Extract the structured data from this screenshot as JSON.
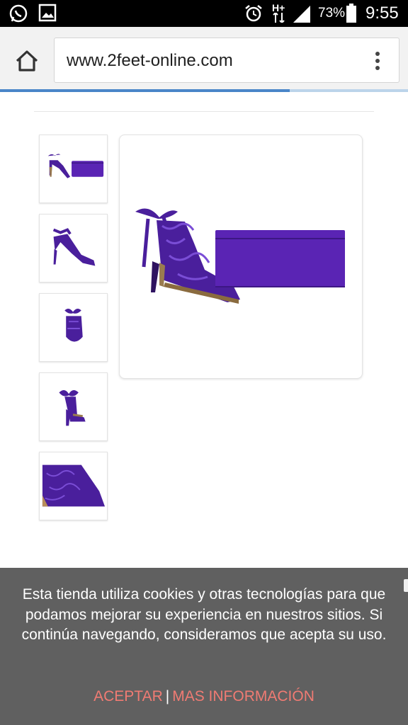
{
  "status_bar": {
    "battery_percent": "73%",
    "time": "9:55",
    "network_label": "H+",
    "icons": [
      "whatsapp-icon",
      "gallery-icon",
      "alarm-icon",
      "network-icon",
      "signal-icon",
      "battery-icon"
    ]
  },
  "browser": {
    "url": "www.2feet-online.com",
    "page_load_progress": 0.71,
    "icons": [
      "home-icon",
      "overflow-menu-icon"
    ]
  },
  "product": {
    "thumbnails": [
      {
        "view": "shoe-and-clutch"
      },
      {
        "view": "side"
      },
      {
        "view": "front"
      },
      {
        "view": "back"
      },
      {
        "view": "detail"
      }
    ],
    "main_image": {
      "view": "shoe-and-clutch"
    },
    "colors": {
      "accent": "#4a1f9c",
      "accent_light": "#6a32c4",
      "heel": "#9a7b4f"
    }
  },
  "cookie_banner": {
    "message": "Esta tienda utiliza cookies y otras tecnologías para que podamos mejorar su experiencia en nuestros sitios. Si continúa navegando, consideramos que acepta su uso.",
    "accept_label": "ACEPTAR",
    "separator": "|",
    "more_info_label": "MAS INFORMACIÓN",
    "link_color": "#f07b73"
  }
}
